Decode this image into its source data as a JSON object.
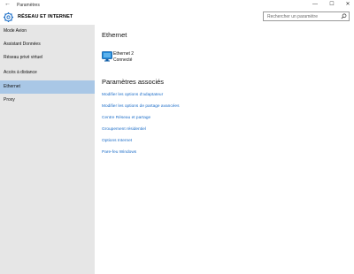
{
  "window": {
    "title": "Paramètres",
    "back_glyph": "←",
    "controls": {
      "minimize": "—",
      "maximize": "☐",
      "close": "✕"
    }
  },
  "header": {
    "section_title": "RÉSEAU ET INTERNET",
    "section_icon": "gear-icon",
    "search": {
      "placeholder": "Rechercher un paramètre",
      "icon": "search-icon"
    }
  },
  "sidebar": {
    "items": [
      {
        "label": "Mode Avion",
        "active": false
      },
      {
        "label": "Assistant Données",
        "active": false
      },
      {
        "label": "Réseau privé virtuel",
        "active": false
      },
      {
        "label": "Accès à distance",
        "active": false
      },
      {
        "label": "Ethernet",
        "active": true
      },
      {
        "label": "Proxy",
        "active": false
      }
    ],
    "active_color": "#a9c7e6"
  },
  "main": {
    "heading": "Ethernet",
    "connection": {
      "name": "Ethernet 2",
      "status": "Connecté",
      "icon": "network-monitor-icon"
    },
    "related_heading": "Paramètres associés",
    "links": [
      "Modifier les options d'adaptateur",
      "Modifier les options de partage avancées",
      "Centre Réseau et partage",
      "Groupement résidentiel",
      "Options Internet",
      "Pare-feu Windows"
    ],
    "link_color": "#1f6fc9"
  }
}
